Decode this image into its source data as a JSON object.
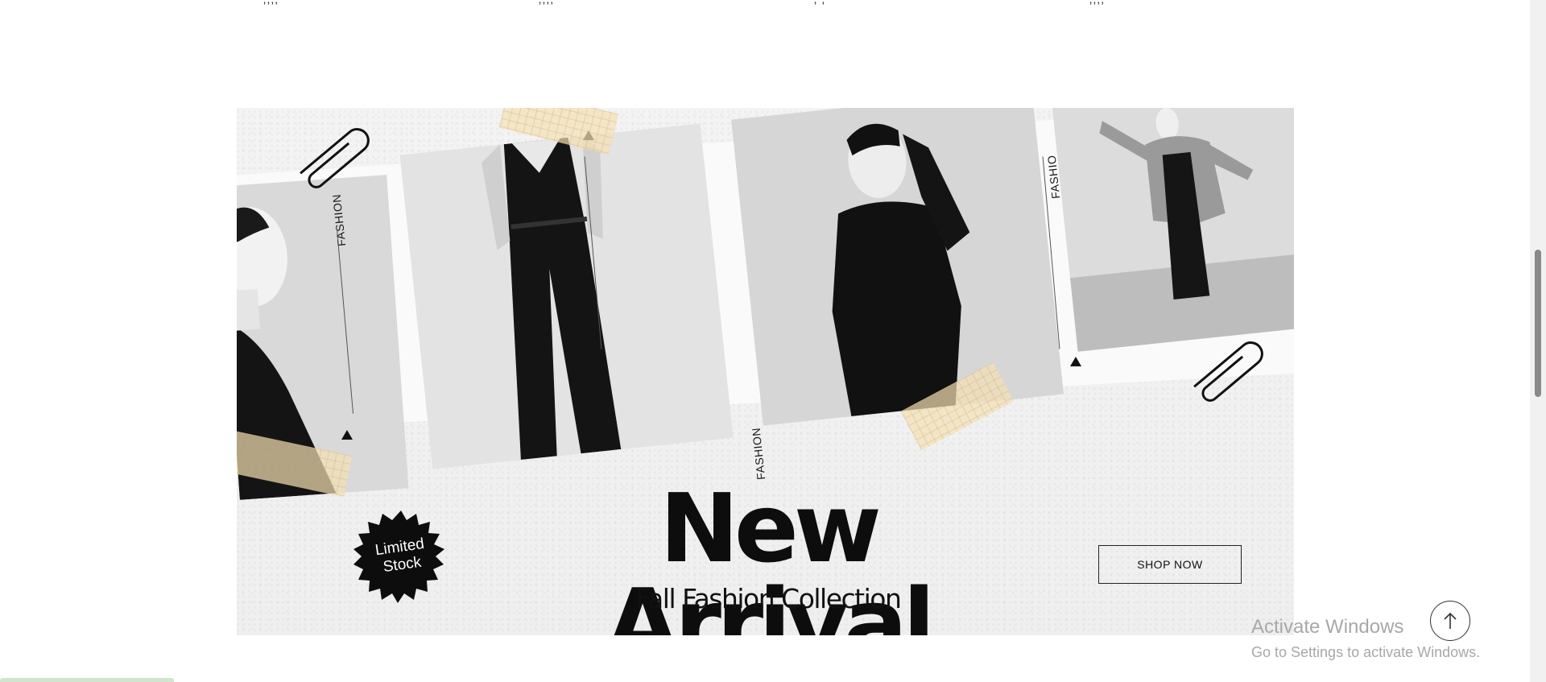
{
  "banner": {
    "headline": "New Arrival",
    "subheadline": "Fall Fashion Collection",
    "badge": "Limited Stock",
    "badge_line1": "Limited",
    "badge_line2": "Stock",
    "cta_label": "SHOP NOW",
    "side_labels": [
      "FASHION",
      "FASHION",
      "FASHIO"
    ],
    "photos": [
      "woman-portrait-profile",
      "pinstripe-suit-outfit",
      "leather-jacket-pose",
      "oversized-blazer-dance"
    ]
  },
  "watermark": {
    "title": "Activate Windows",
    "subtitle": "Go to Settings to activate Windows."
  },
  "icons": {
    "back_to_top": "arrow-up-icon",
    "clip": "paperclip-icon",
    "tape": "washi-tape"
  },
  "colors": {
    "text": "#0d0d0d",
    "banner_bg": "#f2f2f2",
    "tape": "#f4e0b4",
    "watermark": "#a8a8a8"
  }
}
